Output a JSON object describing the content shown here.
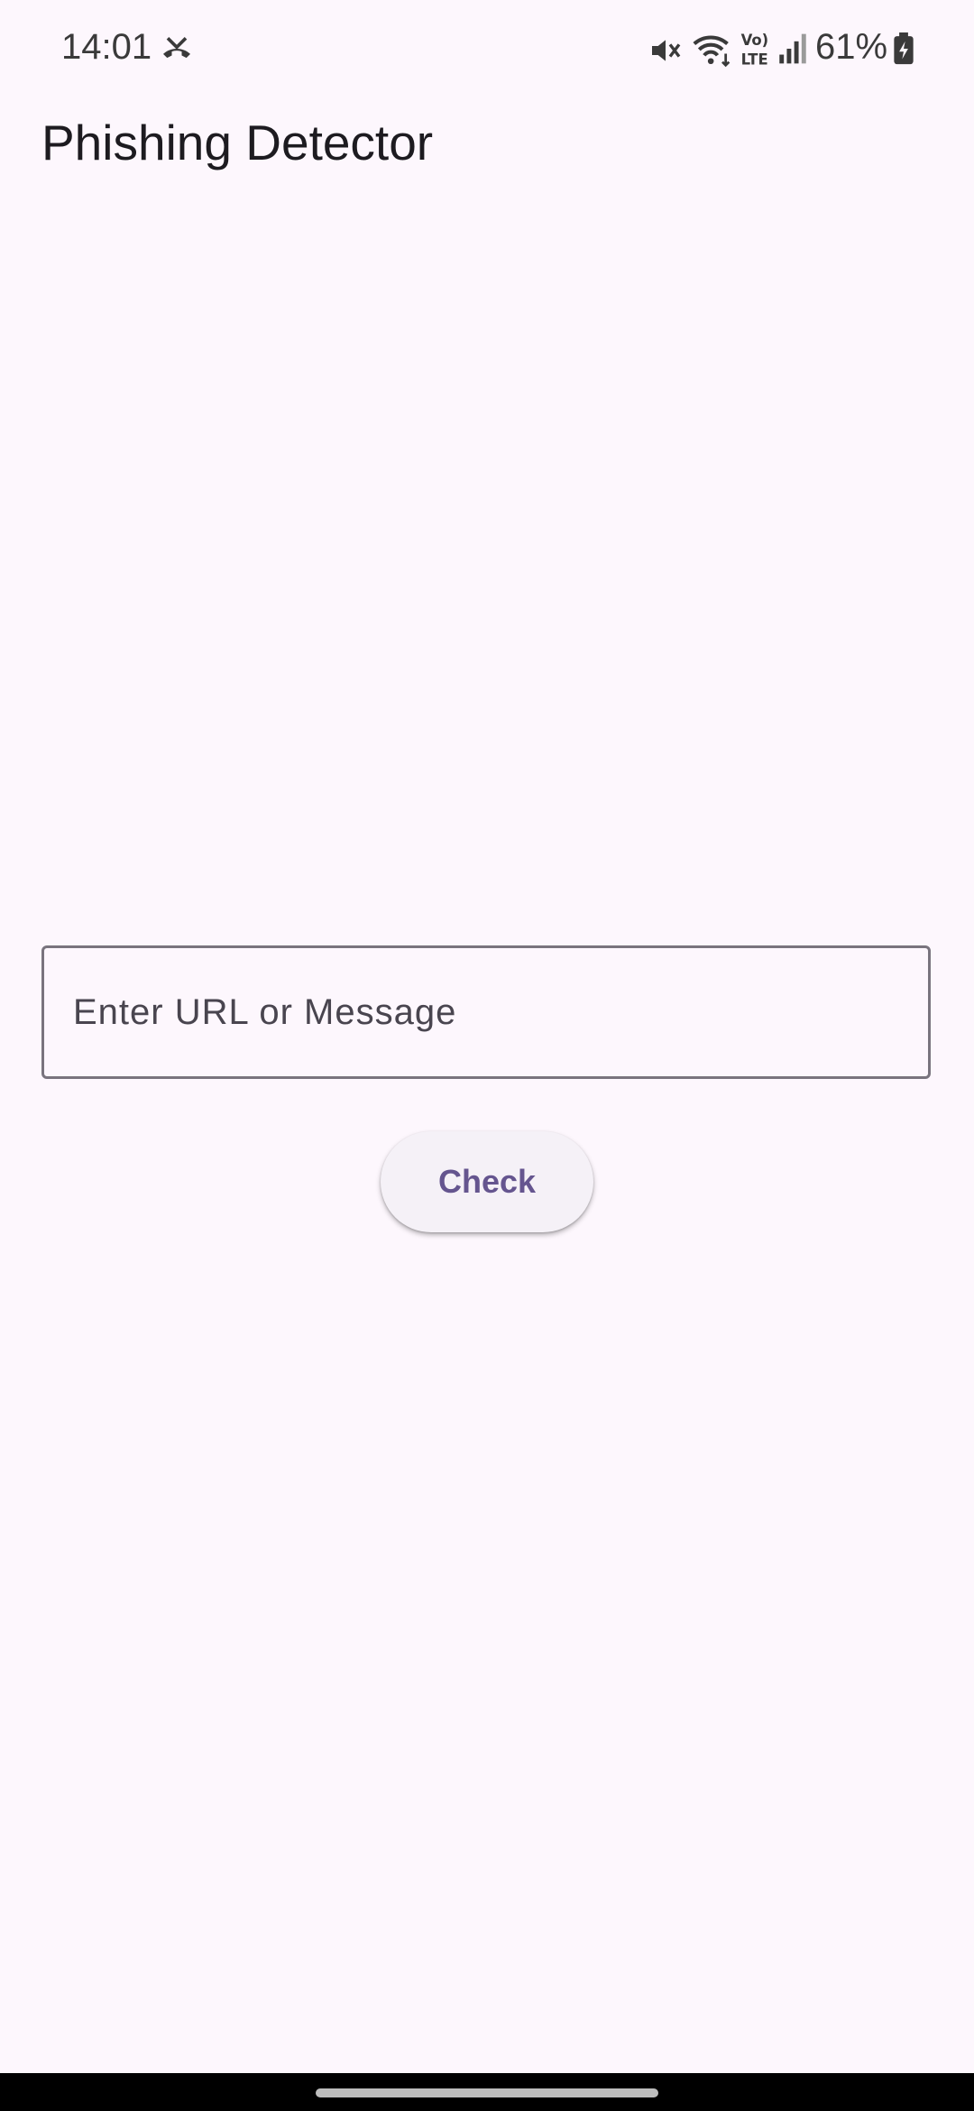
{
  "status_bar": {
    "time": "14:01",
    "battery": "61%",
    "icons": [
      "missed-call-icon",
      "mute-icon",
      "wifi-icon",
      "volte-icon",
      "signal-icon",
      "battery-icon"
    ]
  },
  "app_bar": {
    "title": "Phishing Detector"
  },
  "form": {
    "input_placeholder": "Enter URL or Message",
    "input_value": "",
    "check_label": "Check"
  },
  "colors": {
    "background": "#fdf7fd",
    "accent": "#65558f",
    "outline": "#79747e",
    "button_surface": "#f5f1f7"
  }
}
